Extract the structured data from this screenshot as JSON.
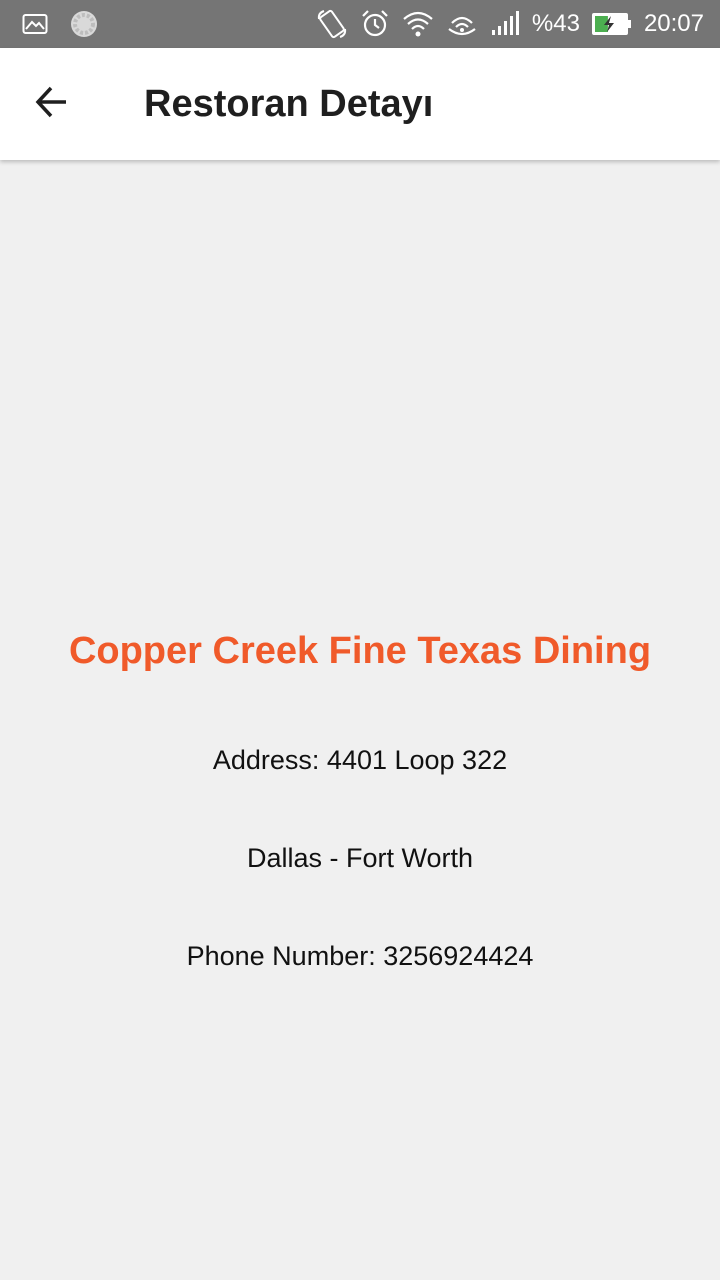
{
  "status_bar": {
    "battery_percent": "%43",
    "time": "20:07",
    "icons": [
      "image-icon",
      "loading-icon",
      "rotate-icon",
      "alarm-icon",
      "wifi-icon",
      "hotspot-icon",
      "signal-icon",
      "battery-charging-icon"
    ],
    "battery_level": 0.43,
    "colors": {
      "bar_bg": "#757575",
      "battery_fill": "#4caf50"
    }
  },
  "app_bar": {
    "title": "Restoran Detayı",
    "back_icon": "arrow-back-icon"
  },
  "restaurant": {
    "name": "Copper Creek Fine Texas Dining",
    "address": "Address: 4401 Loop 322",
    "city": "Dallas - Fort Worth",
    "phone": "Phone Number: 3256924424"
  },
  "colors": {
    "accent": "#f05a2a",
    "background": "#f0f0f0",
    "app_bar_bg": "#ffffff"
  }
}
